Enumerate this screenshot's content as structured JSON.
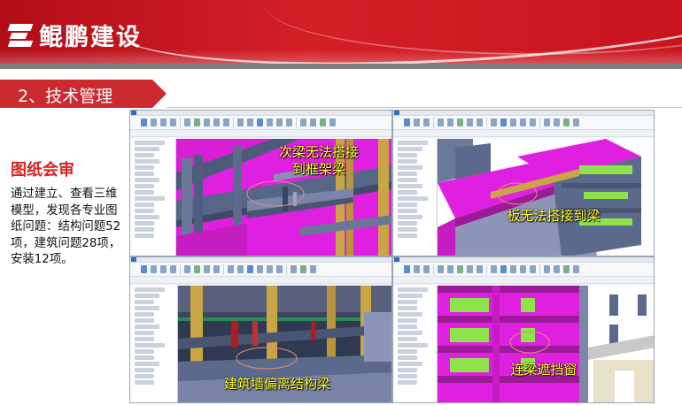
{
  "banner": {
    "company": "鲲鹏建设"
  },
  "section": {
    "title": "2、技术管理"
  },
  "side": {
    "heading": "图纸会审",
    "body": "通过建立、查看三维模型，发现各专业图纸问题：结构问题52项，建筑问题28项，安装12项。"
  },
  "panels": [
    {
      "caption_line1": "次梁无法搭接",
      "caption_line2": "到框架梁"
    },
    {
      "caption": "板无法搭接到梁"
    },
    {
      "caption": "建筑墙偏离结构梁"
    },
    {
      "caption": "连梁遮挡窗"
    }
  ],
  "colors": {
    "brand_red": "#d41f27",
    "section_red": "#cd2a2f",
    "heading_red": "#d92222",
    "caption_yellow": "#ffff33",
    "model_magenta": "#e020e0",
    "model_green": "#8fe34a",
    "model_slate": "#5b6a8c",
    "model_ochre": "#c9a545"
  }
}
